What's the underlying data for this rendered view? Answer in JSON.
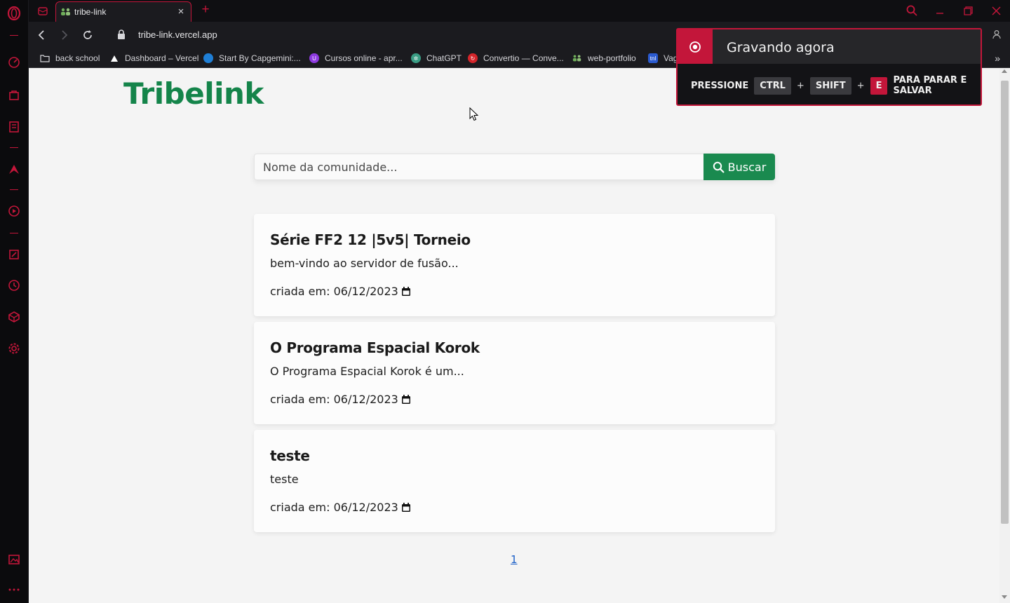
{
  "browser": {
    "tab_title": "tribe-link",
    "url": "tribe-link.vercel.app",
    "bookmarks": [
      {
        "label": "back school",
        "icon": "folder-icon",
        "color": "#1b1b1f"
      },
      {
        "label": "Dashboard – Vercel",
        "icon": "vercel-triangle-icon",
        "color": "#1b1b1f"
      },
      {
        "label": "Start By Capgemini:...",
        "icon": "capgemini-icon",
        "color": "#1f7fd6"
      },
      {
        "label": "Cursos online - apr...",
        "icon": "udemy-icon",
        "color": "#8e3ae0"
      },
      {
        "label": "ChatGPT",
        "icon": "chatgpt-icon",
        "color": "#3a9d84"
      },
      {
        "label": "Convertio — Conve...",
        "icon": "convertio-icon",
        "color": "#d4252a"
      },
      {
        "label": "web-portfolio",
        "icon": "people-icon",
        "color": "#1b1b1f"
      },
      {
        "label": "Vag",
        "icon": "tnel-icon",
        "color": "#2b5bd0"
      }
    ]
  },
  "recording": {
    "title": "Gravando agora",
    "press": "PRESSIONE",
    "key1": "CTRL",
    "plus": "+",
    "key2": "SHIFT",
    "key3": "E",
    "action": "PARA PARAR E SALVAR"
  },
  "page": {
    "logo": "Tribelink",
    "search": {
      "placeholder": "Nome da comunidade...",
      "button_label": "Buscar"
    },
    "communities": [
      {
        "title": "Série FF2 12 |5v5| Torneio",
        "description": "bem-vindo ao servidor de fusão...",
        "date": "criada em: 06/12/2023"
      },
      {
        "title": "O Programa Espacial Korok",
        "description": "O Programa Espacial Korok é um...",
        "date": "criada em: 06/12/2023"
      },
      {
        "title": "teste",
        "description": "teste",
        "date": "criada em: 06/12/2023"
      }
    ],
    "pagination": {
      "current": "1"
    }
  },
  "colors": {
    "brand_green": "#14844a",
    "accent_red": "#c3163a"
  }
}
